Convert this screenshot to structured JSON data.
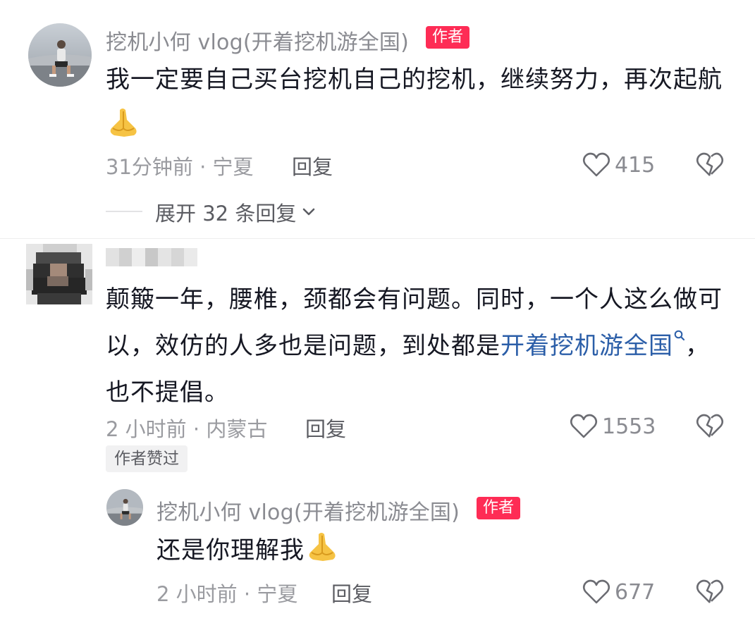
{
  "comment1": {
    "username": "挖机小何 vlog(开着挖机游全国)",
    "badge": "作者",
    "text": "我一定要自己买台挖机自己的挖机，继续努力，再次起航",
    "emoji": "pray-hands-emoji",
    "meta": "31分钟前 · 宁夏",
    "reply": "回复",
    "likes": "415",
    "expand": "展开 32 条回复"
  },
  "comment2": {
    "text_before_link": "颠簸一年，腰椎，颈都会有问题。同时，一个人这么做可以，效仿的人多也是问题，到处都是",
    "link": "开着挖机游全国",
    "text_after_link": "，也不提倡。",
    "meta": "2 小时前 · 内蒙古",
    "reply": "回复",
    "likes": "1553",
    "author_liked": "作者赞过"
  },
  "reply1": {
    "username": "挖机小何 vlog(开着挖机游全国)",
    "badge": "作者",
    "text": "还是你理解我",
    "emoji": "pray-hands-emoji",
    "meta": "2 小时前 · 宁夏",
    "reply": "回复",
    "likes": "677"
  },
  "colors": {
    "badge": "#fe2c55",
    "link": "#2b5ea8",
    "meta": "#9a9ba0",
    "text": "#161823"
  }
}
